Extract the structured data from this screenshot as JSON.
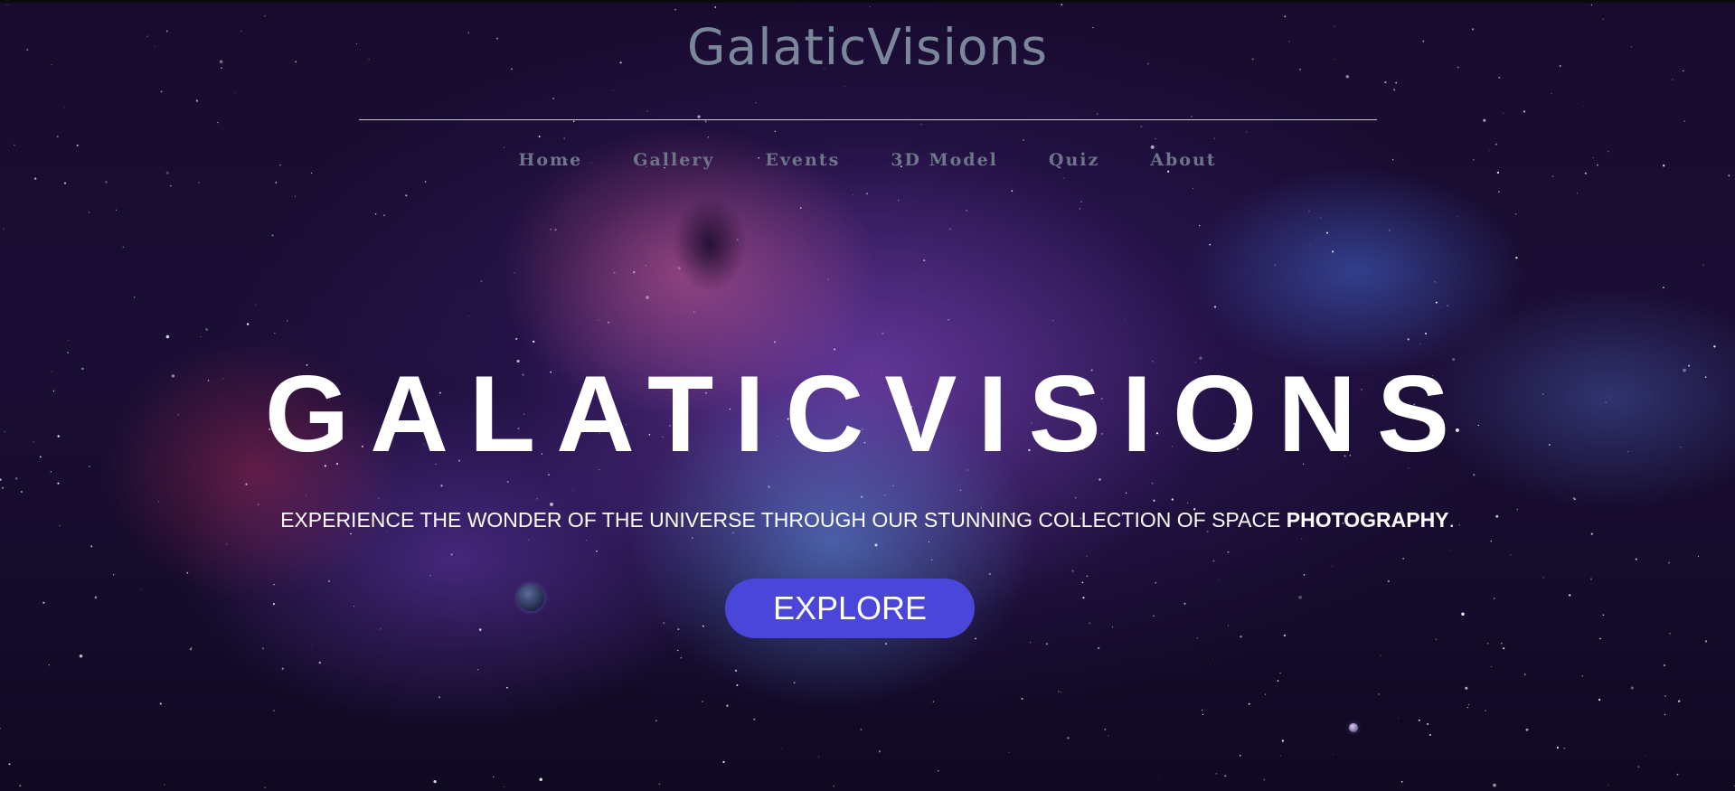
{
  "header": {
    "brand": "GalaticVisions"
  },
  "nav": {
    "items": [
      {
        "label": "Home"
      },
      {
        "label": "Gallery"
      },
      {
        "label": "Events"
      },
      {
        "label": "3D Model"
      },
      {
        "label": "Quiz"
      },
      {
        "label": "About"
      }
    ]
  },
  "hero": {
    "title": "GALATICVISIONS",
    "tagline_main": "EXPERIENCE THE WONDER OF THE UNIVERSE THROUGH OUR STUNNING COLLECTION OF SPACE ",
    "tagline_emphasis": "PHOTOGRAPHY",
    "tagline_end": ".",
    "button_label": "EXPLORE"
  },
  "colors": {
    "brand_text": "#7a8699",
    "nav_text": "#6d7688",
    "hero_text": "#ffffff",
    "button_background": "#4a46d9",
    "background_deep": "#1b0e35"
  }
}
